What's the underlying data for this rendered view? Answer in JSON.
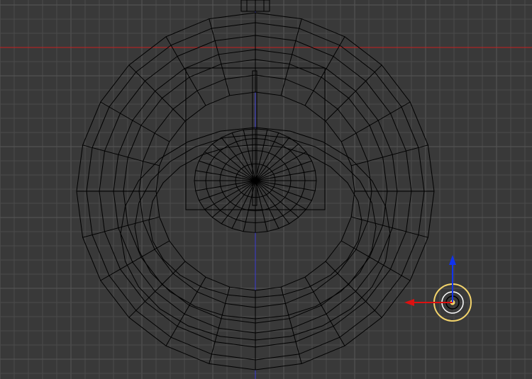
{
  "viewport": {
    "background": "#393939",
    "grid_minor_color": "#4a4a4a",
    "grid_major_color": "#565656",
    "axis_x_color": "#c81e1e",
    "axis_y_color": "#3a3ad2",
    "wire_color": "#000000",
    "selection_color": "#f2d36b",
    "gizmo_x_color": "#dd1111",
    "gizmo_y_color": "#1133ee"
  },
  "icons": {
    "lamp": "lamp-icon",
    "transform_gizmo": "transform-manipulator-icon",
    "object": "wireframe-mesh-icon"
  }
}
